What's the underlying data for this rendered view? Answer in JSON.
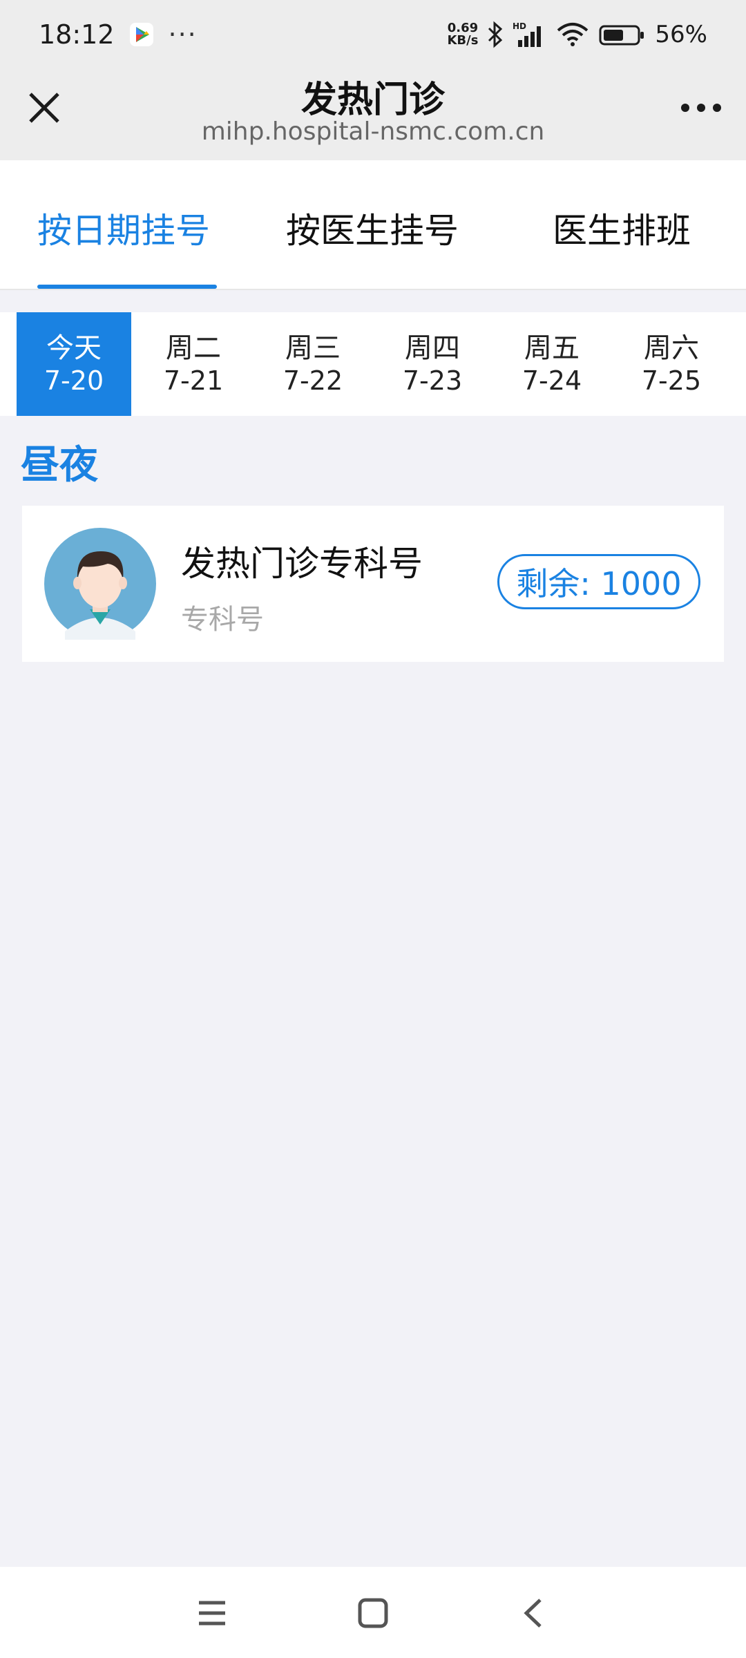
{
  "status_bar": {
    "time": "18:12",
    "overflow": "···",
    "speed_value": "0.69",
    "speed_unit": "KB/s",
    "battery_percent": "56%",
    "icons": [
      "play-store-icon",
      "bluetooth-icon",
      "hd-signal-icon",
      "wifi-icon",
      "battery-icon"
    ]
  },
  "header": {
    "title": "发热门诊",
    "url": "mihp.hospital-nsmc.com.cn"
  },
  "tabs": [
    {
      "label": "按日期挂号",
      "active": true
    },
    {
      "label": "按医生挂号",
      "active": false
    },
    {
      "label": "医生排班",
      "active": false
    }
  ],
  "dates": [
    {
      "day": "今天",
      "date": "7-20",
      "selected": true
    },
    {
      "day": "周二",
      "date": "7-21",
      "selected": false
    },
    {
      "day": "周三",
      "date": "7-22",
      "selected": false
    },
    {
      "day": "周四",
      "date": "7-23",
      "selected": false
    },
    {
      "day": "周五",
      "date": "7-24",
      "selected": false
    },
    {
      "day": "周六",
      "date": "7-25",
      "selected": false
    }
  ],
  "section": {
    "title": "昼夜"
  },
  "clinic_card": {
    "name": "发热门诊专科号",
    "type": "专科号",
    "remaining": "剩余: 1000"
  },
  "colors": {
    "accent": "#1a82e2",
    "background": "#f2f2f7",
    "header_bg": "#ededed"
  }
}
